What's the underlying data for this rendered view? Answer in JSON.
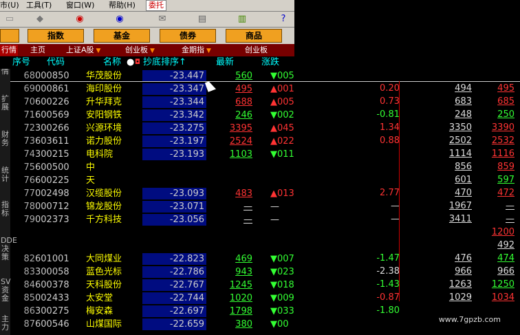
{
  "menu": [
    "市(U)",
    "工具(T)",
    "窗口(W)",
    "帮助(H)",
    "委托"
  ],
  "toolbar_icons": [
    "diamond-icon",
    "quote-icon",
    "chart-icon",
    "mail-icon",
    "panel-icon",
    "books-icon",
    "help-cursor-icon"
  ],
  "categories": [
    "指数",
    "基金",
    "债券",
    "商品"
  ],
  "tabs": [
    {
      "label": "行情",
      "arrow": false
    },
    {
      "label": "主页",
      "arrow": false
    },
    {
      "label": "上证A股",
      "arrow": true
    },
    {
      "label": "创业板",
      "arrow": true
    },
    {
      "label": "金期指",
      "arrow": true
    },
    {
      "label": "创业板",
      "arrow": false
    }
  ],
  "columns": {
    "seq": "序号",
    "code": "代码",
    "name": "名称",
    "sort": "抄底排序↑",
    "last": "最新",
    "chg": "涨跌"
  },
  "sidebar": [
    "行情",
    "扩展",
    "财务",
    "统计",
    "指标",
    "DDE决策",
    "SV资金",
    "主力"
  ],
  "rows": [
    {
      "idx": "68",
      "code": "000850",
      "name": "华茂股份",
      "sort": "-23.447",
      "last": "560",
      "dir": "dn",
      "chg": "▼005"
    },
    {
      "idx": "69",
      "code": "000861",
      "name": "海印股份",
      "sort": "-23.347",
      "last": "495",
      "dir": "up",
      "chg": "▲001"
    },
    {
      "idx": "70",
      "code": "600226",
      "name": "升华拜克",
      "sort": "-23.344",
      "last": "688",
      "dir": "up",
      "chg": "▲005"
    },
    {
      "idx": "71",
      "code": "600569",
      "name": "安阳钢铁",
      "sort": "-23.342",
      "last": "246",
      "dir": "dn",
      "chg": "▼002"
    },
    {
      "idx": "72",
      "code": "300266",
      "name": "兴源环境",
      "sort": "-23.275",
      "last": "3395",
      "dir": "up",
      "chg": "▲045"
    },
    {
      "idx": "73",
      "code": "603611",
      "name": "诺力股份",
      "sort": "-23.197",
      "last": "2524",
      "dir": "up",
      "chg": "▲022"
    },
    {
      "idx": "74",
      "code": "300215",
      "name": "电科院",
      "sort": "-23.193",
      "last": "1103",
      "dir": "dn",
      "chg": "▼011"
    },
    {
      "idx": "75",
      "code": "600500",
      "name": "中",
      "sort": "",
      "last": "",
      "dir": "wh",
      "chg": ""
    },
    {
      "idx": "76",
      "code": "600225",
      "name": "天",
      "sort": "",
      "last": "",
      "dir": "wh",
      "chg": ""
    },
    {
      "idx": "77",
      "code": "002498",
      "name": "汉缆股份",
      "sort": "-23.093",
      "last": "483",
      "dir": "up",
      "chg": "▲013"
    },
    {
      "idx": "78",
      "code": "000712",
      "name": "锦龙股份",
      "sort": "-23.071",
      "last": "—",
      "dir": "wh",
      "chg": "—"
    },
    {
      "idx": "79",
      "code": "002373",
      "name": "千方科技",
      "sort": "-23.056",
      "last": "—",
      "dir": "wh",
      "chg": "—"
    },
    {
      "idx": "",
      "code": "",
      "name": "",
      "sort": "",
      "last": "",
      "dir": "wh",
      "chg": ""
    },
    {
      "idx": "",
      "code": "",
      "name": "",
      "sort": "",
      "last": "",
      "dir": "wh",
      "chg": ""
    },
    {
      "idx": "82",
      "code": "601001",
      "name": "大同煤业",
      "sort": "-22.823",
      "last": "469",
      "dir": "dn",
      "chg": "▼007"
    },
    {
      "idx": "83",
      "code": "300058",
      "name": "蓝色光标",
      "sort": "-22.786",
      "last": "943",
      "dir": "dn",
      "chg": "▼023"
    },
    {
      "idx": "84",
      "code": "600378",
      "name": "天科股份",
      "sort": "-22.767",
      "last": "1245",
      "dir": "dn",
      "chg": "▼018"
    },
    {
      "idx": "85",
      "code": "002433",
      "name": "太安堂",
      "sort": "-22.744",
      "last": "1020",
      "dir": "dn",
      "chg": "▼009"
    },
    {
      "idx": "86",
      "code": "300275",
      "name": "梅安森",
      "sort": "-22.697",
      "last": "1798",
      "dir": "dn",
      "chg": "▼033"
    },
    {
      "idx": "87",
      "code": "600546",
      "name": "山煤国际",
      "sort": "-22.659",
      "last": "380",
      "dir": "dn",
      "chg": "▼00"
    }
  ],
  "right_rows": [
    {
      "chg": "",
      "v1": "",
      "v2": "",
      "dir": "wh"
    },
    {
      "chg": "0.20",
      "v1": "494",
      "v2": "495",
      "dir": "up"
    },
    {
      "chg": "0.73",
      "v1": "683",
      "v2": "685",
      "dir": "up"
    },
    {
      "chg": "-0.81",
      "v1": "248",
      "v2": "250",
      "dir": "dn"
    },
    {
      "chg": "1.34",
      "v1": "3350",
      "v2": "3390",
      "dir": "up"
    },
    {
      "chg": "0.88",
      "v1": "2502",
      "v2": "2532",
      "dir": "up"
    },
    {
      "chg": "",
      "v1": "1114",
      "v2": "1116",
      "dir": "up"
    },
    {
      "chg": "",
      "v1": "856",
      "v2": "859",
      "dir": "up"
    },
    {
      "chg": "",
      "v1": "601",
      "v2": "597",
      "dir": "dn"
    },
    {
      "chg": "2.77",
      "v1": "470",
      "v2": "472",
      "dir": "up"
    },
    {
      "chg": "—",
      "v1": "1967",
      "v2": "—",
      "dir": "wh"
    },
    {
      "chg": "—",
      "v1": "3411",
      "v2": "—",
      "dir": "wh"
    },
    {
      "chg": "",
      "v1": "",
      "v2": "1200",
      "dir": "up"
    },
    {
      "chg": "",
      "v1": "",
      "v2": "492",
      "dir": "wh"
    },
    {
      "chg": "-1.47",
      "v1": "476",
      "v2": "474",
      "dir": "dn"
    },
    {
      "chg": "-2.38",
      "v1": "966",
      "v2": "966",
      "dir": "wh"
    },
    {
      "chg": "-1.43",
      "v1": "1263",
      "v2": "1250",
      "dir": "dn"
    },
    {
      "chg": "-0.87",
      "v1": "1029",
      "v2": "1034",
      "dir": "up"
    },
    {
      "chg": "-1.80",
      "v1": "",
      "v2": "",
      "dir": "dn"
    }
  ],
  "watermark": "www.7gpzb.com"
}
